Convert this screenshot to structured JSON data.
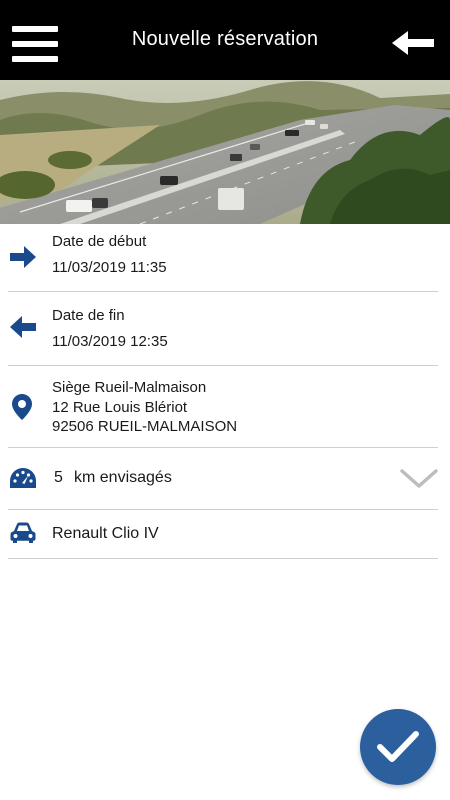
{
  "header": {
    "title": "Nouvelle réservation",
    "menu_icon": "hamburger-menu-icon",
    "back_icon": "arrow-left-icon"
  },
  "colors": {
    "header_bg": "#000000",
    "accent": "#1b4a8c",
    "fab": "#2b5f9e",
    "divider": "#cfcfcf"
  },
  "booking": {
    "start": {
      "label": "Date de début",
      "value": "11/03/2019 11:35",
      "icon": "arrow-right-icon"
    },
    "end": {
      "label": "Date de fin",
      "value": "11/03/2019 12:35",
      "icon": "arrow-left-icon"
    },
    "location": {
      "icon": "location-pin-icon",
      "name": "Siège Rueil-Malmaison",
      "street": "12 Rue Louis Blériot",
      "city": "92506 RUEIL-MALMAISON"
    },
    "distance": {
      "icon": "speedometer-icon",
      "value": "5",
      "unit": "km envisagés",
      "dropdown_icon": "chevron-down-icon"
    },
    "vehicle": {
      "icon": "car-icon",
      "name": "Renault Clio IV"
    }
  },
  "actions": {
    "confirm_icon": "checkmark-icon"
  }
}
